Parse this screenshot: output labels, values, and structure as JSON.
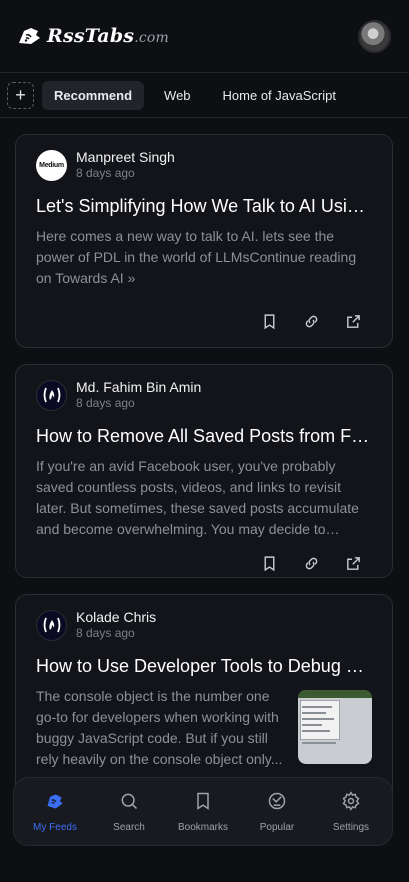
{
  "app": {
    "logo_text": "RssTabs",
    "logo_suffix": ".com"
  },
  "tabs": {
    "add_label": "+",
    "items": [
      {
        "label": "Recommend",
        "active": true
      },
      {
        "label": "Web",
        "active": false
      },
      {
        "label": "Home of JavaScript",
        "active": false
      }
    ]
  },
  "feed": [
    {
      "source_icon": "medium-logo",
      "source_badge": "Medium",
      "author": "Manpreet Singh",
      "time": "8 days ago",
      "title": "Let's Simplifying How We Talk to AI Using PDL",
      "description": "Here comes a new way to talk to AI. lets see the power of PDL in the world of LLMsContinue reading on Towards AI »",
      "has_thumbnail": false
    },
    {
      "source_icon": "freecodecamp-logo",
      "author": "Md. Fahim Bin Amin",
      "time": "8 days ago",
      "title": "How to Remove All Saved Posts from Facebook",
      "description": "If you're an avid Facebook user, you've probably saved countless posts, videos, and links to revisit later. But sometimes, these saved posts accumulate and become overwhelming. You may decide to unsave them.",
      "has_thumbnail": false
    },
    {
      "source_icon": "freecodecamp-logo",
      "author": "Kolade Chris",
      "time": "8 days ago",
      "title": "How to Use Developer Tools to Debug JavaScript",
      "description": "The console object is the number one go-to for developers when working with buggy JavaScript code. But if you still rely heavily on the console object only...",
      "has_thumbnail": true
    }
  ],
  "card_actions": [
    "bookmark-icon",
    "link-icon",
    "share-icon"
  ],
  "bottom_nav": [
    {
      "label": "My Feeds",
      "icon": "feeds-icon",
      "active": true
    },
    {
      "label": "Search",
      "icon": "search-icon",
      "active": false
    },
    {
      "label": "Bookmarks",
      "icon": "bookmark-icon",
      "active": false
    },
    {
      "label": "Popular",
      "icon": "popular-icon",
      "active": false
    },
    {
      "label": "Settings",
      "icon": "gear-icon",
      "active": false
    }
  ],
  "colors": {
    "background": "#0e0f13",
    "card": "#131419",
    "accent": "#3b6ef5",
    "muted_text": "#8c909a"
  }
}
